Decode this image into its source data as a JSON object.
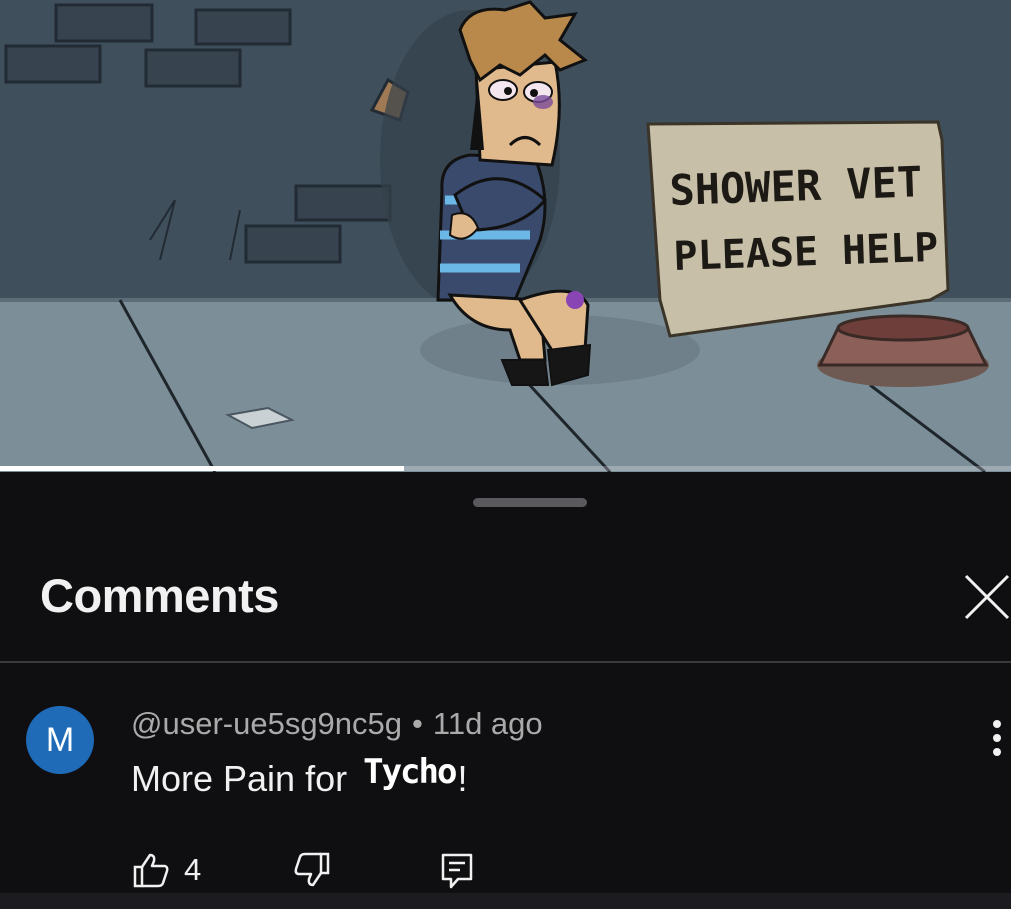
{
  "video": {
    "sign_line1": "SHOWER VET",
    "sign_line2": "PLEASE HELP",
    "progress": 0.4
  },
  "comments_panel": {
    "title": "Comments",
    "close_icon": "close-icon"
  },
  "comment": {
    "avatar_initial": "M",
    "avatar_color": "#1f6bb8",
    "username": "@user-ue5sg9nc5g",
    "separator": "•",
    "time": "11d ago",
    "text_prefix": "More Pain for",
    "text_handwritten": "Tycho",
    "text_suffix": "!",
    "like_count": "4",
    "icons": {
      "like": "thumbs-up-icon",
      "dislike": "thumbs-down-icon",
      "reply": "reply-icon",
      "more": "more-vertical-icon"
    }
  }
}
